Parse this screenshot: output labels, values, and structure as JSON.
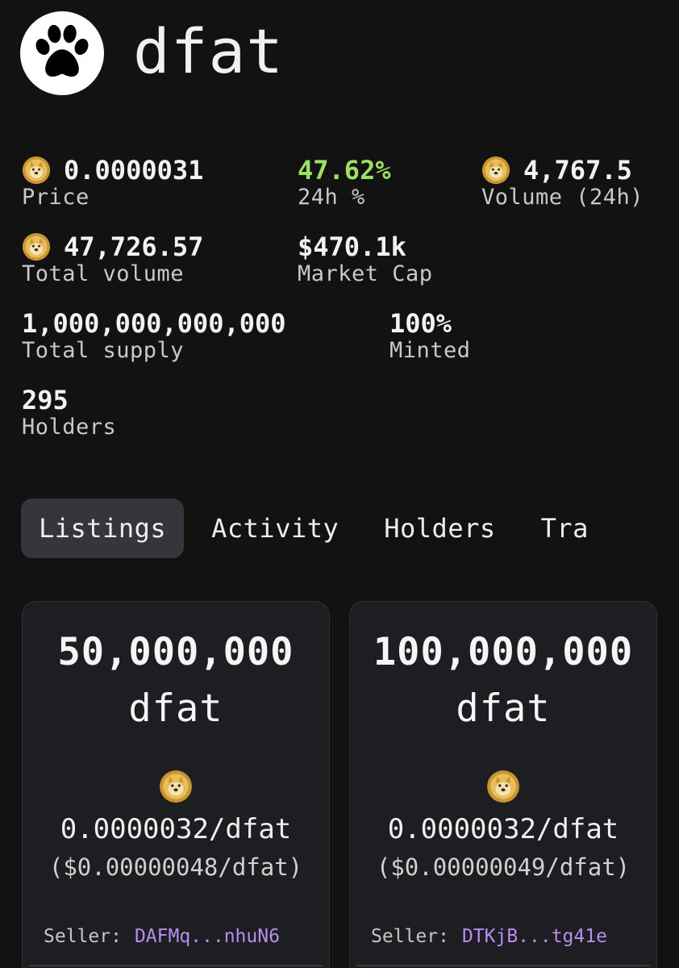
{
  "token": {
    "name": "dfat",
    "logo_icon": "paw-icon"
  },
  "stats": {
    "price": {
      "value": "0.0000031",
      "label": "Price",
      "icon": "doge-coin-icon"
    },
    "change_24h": {
      "value": "47.62%",
      "label": "24h %",
      "color": "#9be05f"
    },
    "volume_24h": {
      "value": "4,767.5",
      "label": "Volume (24h)",
      "icon": "doge-coin-icon"
    },
    "total_volume": {
      "value": "47,726.57",
      "label": "Total volume",
      "icon": "doge-coin-icon"
    },
    "market_cap": {
      "value": "$470.1k",
      "label": "Market Cap"
    },
    "total_supply": {
      "value": "1,000,000,000,000",
      "label": "Total supply"
    },
    "minted": {
      "value": "100%",
      "label": "Minted"
    },
    "holders": {
      "value": "295",
      "label": "Holders"
    }
  },
  "tabs": [
    {
      "label": "Listings",
      "active": true
    },
    {
      "label": "Activity",
      "active": false
    },
    {
      "label": "Holders",
      "active": false
    },
    {
      "label": "Tra",
      "active": false
    }
  ],
  "listings": [
    {
      "amount": "50,000,000",
      "unit": "dfat",
      "price": "0.0000032/dfat",
      "usd": "($0.00000048/dfat)",
      "seller_label": "Seller:",
      "seller": "DAFMq...nhuN6"
    },
    {
      "amount": "100,000,000",
      "unit": "dfat",
      "price": "0.0000032/dfat",
      "usd": "($0.00000049/dfat)",
      "seller_label": "Seller:",
      "seller": "DTKjB...tg41e"
    }
  ],
  "colors": {
    "background": "#121212",
    "card": "#1d1e22",
    "active_tab": "#34363b",
    "positive": "#9be05f",
    "seller_link": "#b98cf0",
    "coin": "#d9a93f"
  }
}
